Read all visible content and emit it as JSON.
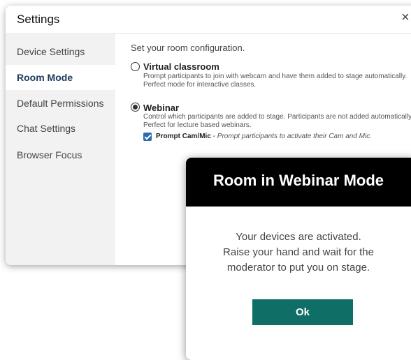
{
  "settings": {
    "title": "Settings",
    "close_icon": "×",
    "sidebar": {
      "items": [
        {
          "label": "Device Settings"
        },
        {
          "label": "Room Mode",
          "active": true
        },
        {
          "label": "Default Permissions"
        },
        {
          "label": "Chat Settings"
        },
        {
          "label": "Browser Focus"
        }
      ]
    },
    "content": {
      "intro": "Set your room configuration.",
      "options": [
        {
          "title": "Virtual classroom",
          "desc_line1": "Prompt participants to join with webcam and have them added to stage automatically.",
          "desc_line2": "Perfect mode for interactive classes.",
          "checked": false
        },
        {
          "title": "Webinar",
          "desc_line1": "Control which participants are added to stage. Participants are not added automatically.",
          "desc_line2": "Perfect for lecture based webinars.",
          "checked": true
        }
      ],
      "checkbox": {
        "label_bold": "Prompt Cam/Mic",
        "separator": " - ",
        "label_italic": "Prompt participants to activate their Cam and Mic.",
        "checked": true
      }
    }
  },
  "modal": {
    "title": "Room in Webinar Mode",
    "message_lines": [
      "Your devices are activated.",
      "Raise your hand and wait for the",
      "moderator to put you on stage."
    ],
    "ok_label": "Ok"
  },
  "colors": {
    "accent": "#0f6e66",
    "checkbox": "#2b6cb0",
    "modal_header": "#000000"
  }
}
